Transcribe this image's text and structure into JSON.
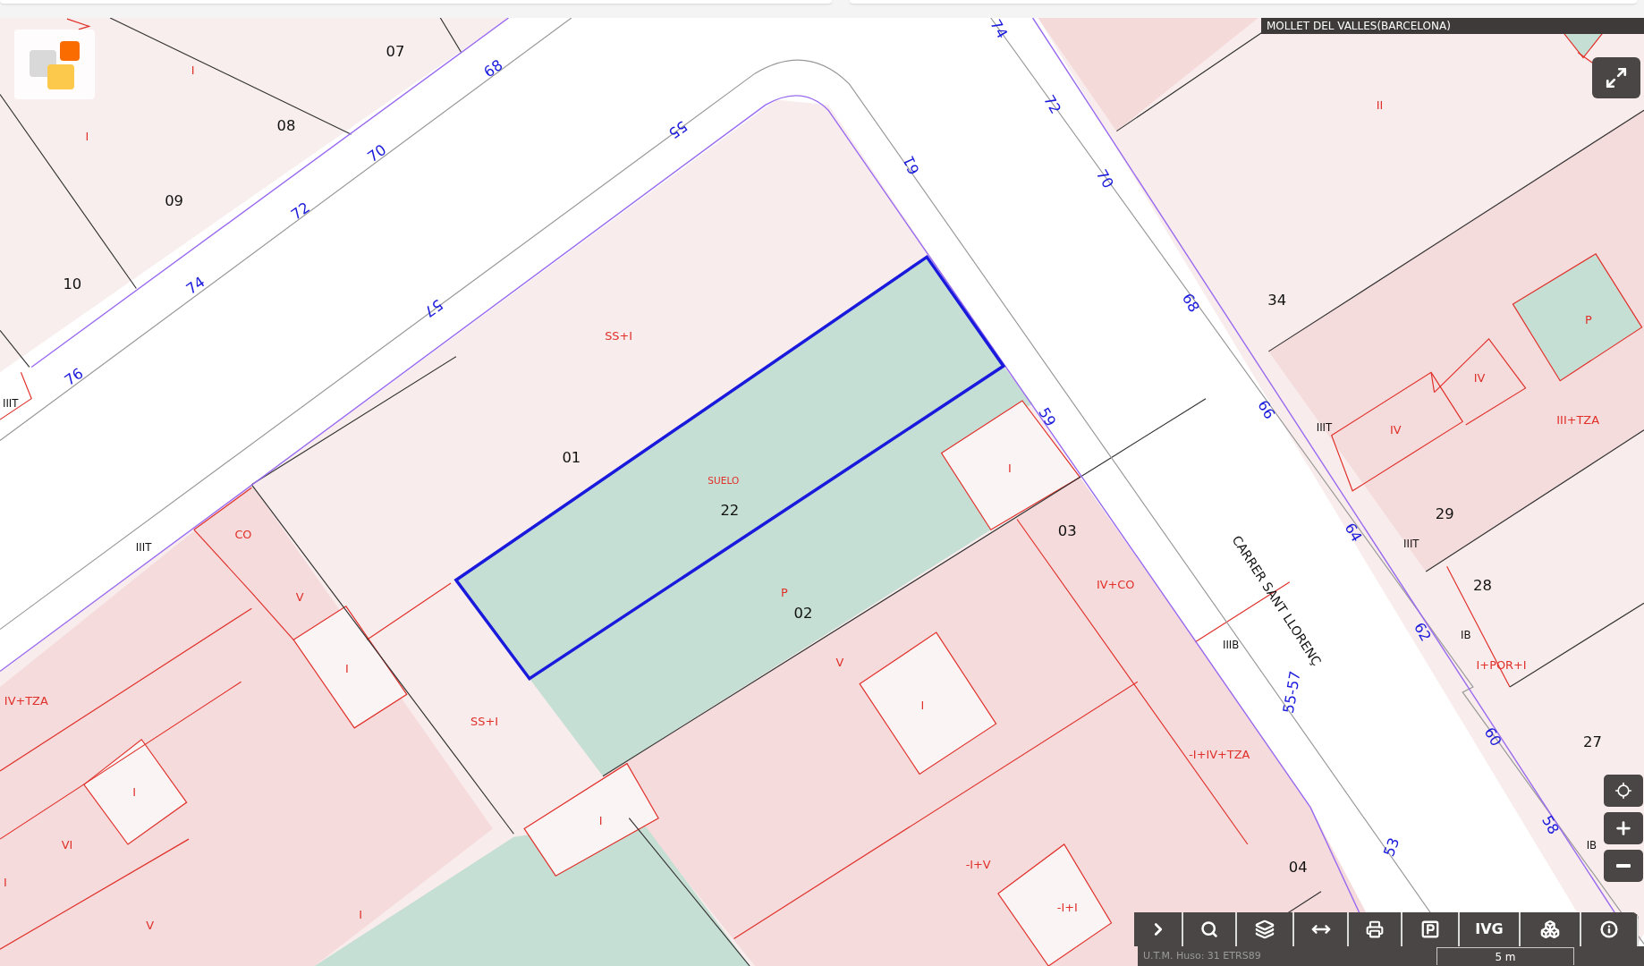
{
  "location_bar": {
    "title": "MOLLET DEL VALLES(BARCELONA)"
  },
  "map": {
    "parcel_numbers": [
      "07",
      "08",
      "09",
      "10",
      "01",
      "22",
      "02",
      "03",
      "04",
      "34",
      "29",
      "28",
      "27"
    ],
    "floor_labels": [
      "I",
      "I",
      "SS+I",
      "SUELO",
      "P",
      "CO",
      "V",
      "I",
      "IV+TZA",
      "SS+I",
      "I",
      "V",
      "I",
      "I",
      "VI",
      "I",
      "V",
      "I",
      "-I+V",
      "-I+I",
      "IV+CO",
      "-I+IV+TZA",
      "II",
      "P",
      "IV",
      "IV",
      "III+TZA",
      "I+POR+I",
      "I"
    ],
    "building_codes": [
      "IIIT",
      "IIIT",
      "IIIB",
      "IIIT",
      "IIIT",
      "IB",
      "IB"
    ],
    "street_numbers": [
      "68",
      "70",
      "72",
      "74",
      "76",
      "55",
      "57",
      "61",
      "59",
      "74",
      "72",
      "70",
      "68",
      "66",
      "64",
      "62",
      "60",
      "58",
      "53",
      "55-57"
    ],
    "street_name": "CARRER SANT LLORENÇ"
  },
  "toolbar": {
    "text_button": "IVG"
  },
  "status_bar": {
    "coordinates": "U.T.M. Huso: 31 ETRS89",
    "scale": "5 m"
  }
}
